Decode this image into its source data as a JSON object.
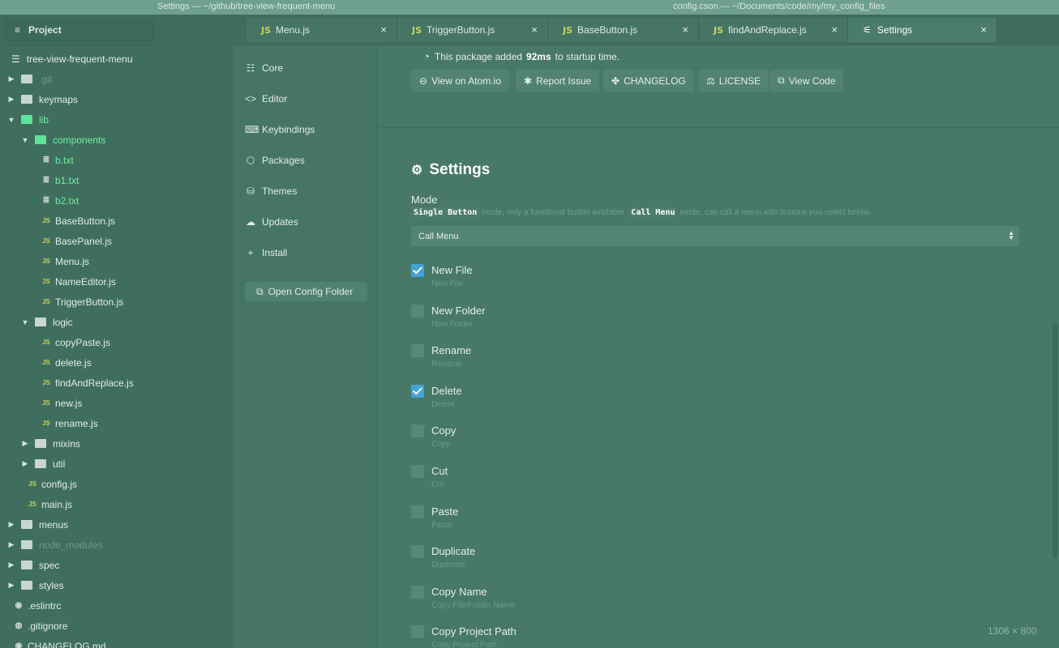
{
  "window": {
    "title_left": "Settings — ~/github/tree-view-frequent-menu",
    "title_right": "config.cson — ~/Documents/code/my/my_config_files"
  },
  "tabs": {
    "project": "Project",
    "items": [
      {
        "label": "Menu.js",
        "type": "JS"
      },
      {
        "label": "TriggerButton.js",
        "type": "JS"
      },
      {
        "label": "BaseButton.js",
        "type": "JS"
      },
      {
        "label": "findAndReplace.js",
        "type": "JS"
      },
      {
        "label": "Settings",
        "type": "settings"
      }
    ],
    "close_glyph": "×"
  },
  "tree": {
    "root": "tree-view-frequent-menu",
    "items": [
      {
        "label": ".git",
        "kind": "folder",
        "state": "collapsed"
      },
      {
        "label": "keymaps",
        "kind": "folder",
        "state": "collapsed"
      },
      {
        "label": "lib",
        "kind": "folder",
        "state": "expanded"
      },
      {
        "label": "components",
        "kind": "folder",
        "state": "expanded"
      },
      {
        "label": "b.txt",
        "kind": "text"
      },
      {
        "label": "b1.txt",
        "kind": "text"
      },
      {
        "label": "b2.txt",
        "kind": "text"
      },
      {
        "label": "BaseButton.js",
        "kind": "js"
      },
      {
        "label": "BasePanel.js",
        "kind": "js"
      },
      {
        "label": "Menu.js",
        "kind": "js"
      },
      {
        "label": "NameEditor.js",
        "kind": "js"
      },
      {
        "label": "TriggerButton.js",
        "kind": "js"
      },
      {
        "label": "logic",
        "kind": "folder",
        "state": "expanded"
      },
      {
        "label": "copyPaste.js",
        "kind": "js"
      },
      {
        "label": "delete.js",
        "kind": "js"
      },
      {
        "label": "findAndReplace.js",
        "kind": "js"
      },
      {
        "label": "new.js",
        "kind": "js"
      },
      {
        "label": "rename.js",
        "kind": "js"
      },
      {
        "label": "mixins",
        "kind": "folder",
        "state": "collapsed"
      },
      {
        "label": "util",
        "kind": "folder",
        "state": "collapsed"
      },
      {
        "label": "config.js",
        "kind": "js"
      },
      {
        "label": "main.js",
        "kind": "js"
      },
      {
        "label": "menus",
        "kind": "folder",
        "state": "collapsed"
      },
      {
        "label": "node_modules",
        "kind": "folder",
        "state": "ignored"
      },
      {
        "label": "spec",
        "kind": "folder",
        "state": "collapsed"
      },
      {
        "label": "styles",
        "kind": "folder",
        "state": "collapsed"
      },
      {
        "label": ".eslintrc",
        "kind": "config"
      },
      {
        "label": ".gitignore",
        "kind": "git"
      },
      {
        "label": "CHANGELOG.md",
        "kind": "md"
      }
    ],
    "js_badge": "JS"
  },
  "settings_nav": {
    "items": [
      {
        "label": "Core",
        "icon": "sliders-icon"
      },
      {
        "label": "Editor",
        "icon": "code-icon"
      },
      {
        "label": "Keybindings",
        "icon": "keyboard-icon"
      },
      {
        "label": "Packages",
        "icon": "package-icon"
      },
      {
        "label": "Themes",
        "icon": "paintcan-icon"
      },
      {
        "label": "Updates",
        "icon": "cloud-download-icon"
      },
      {
        "label": "Install",
        "icon": "plus-icon"
      }
    ],
    "open_config": "Open Config Folder"
  },
  "package": {
    "startup_pre": "This package added",
    "startup_ms": "92ms",
    "startup_post": "to startup time.",
    "buttons": [
      {
        "label": "View on Atom.io",
        "icon": "link-icon"
      },
      {
        "label": "Report Issue",
        "icon": "bug-icon"
      },
      {
        "label": "CHANGELOG",
        "icon": "squirrel-icon"
      },
      {
        "label": "LICENSE",
        "icon": "law-icon"
      },
      {
        "label": "View Code",
        "icon": "external-link-icon"
      }
    ]
  },
  "settings": {
    "title": "Settings",
    "mode_label": "Mode",
    "mode_desc_code1": "Single Button",
    "mode_desc_mid": "mode, only a functional button available.",
    "mode_desc_code2": "Call Menu",
    "mode_desc_end": "mode, can call a menu with buttons you select below.",
    "mode_value": "Call Menu",
    "options": [
      {
        "label": "New File",
        "desc": "New File",
        "checked": true
      },
      {
        "label": "New Folder",
        "desc": "New Folder",
        "checked": false
      },
      {
        "label": "Rename",
        "desc": "Rename",
        "checked": false
      },
      {
        "label": "Delete",
        "desc": "Delete",
        "checked": true
      },
      {
        "label": "Copy",
        "desc": "Copy",
        "checked": false
      },
      {
        "label": "Cut",
        "desc": "Cut",
        "checked": false
      },
      {
        "label": "Paste",
        "desc": "Paste",
        "checked": false
      },
      {
        "label": "Duplicate",
        "desc": "Duplicate",
        "checked": false
      },
      {
        "label": "Copy Name",
        "desc": "Copy File/Folder Name",
        "checked": false
      },
      {
        "label": "Copy Project Path",
        "desc": "Copy Project Path",
        "checked": false
      }
    ]
  },
  "size_badge": "1306 × 800",
  "colors": {
    "accent": "#41a3d6",
    "highlight": "#6ef0a4",
    "background": "#477868"
  }
}
